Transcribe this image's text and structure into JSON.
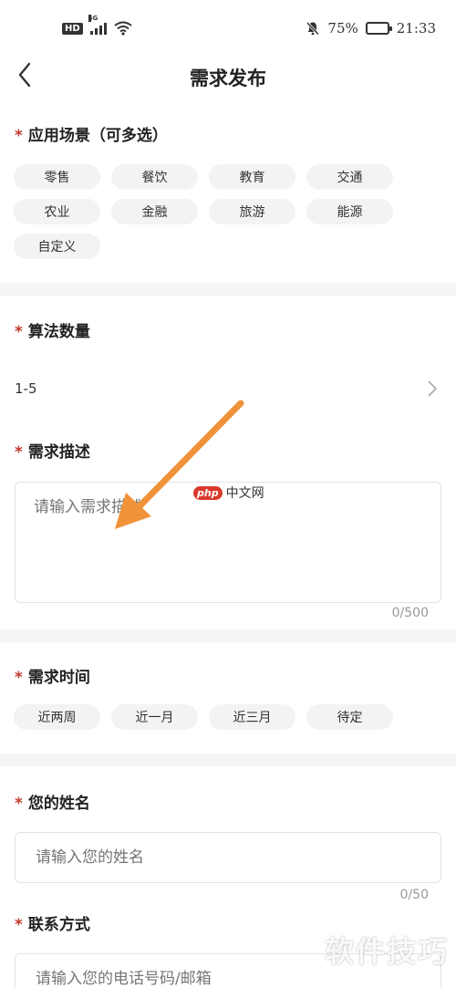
{
  "status_bar": {
    "hd": "HD",
    "network": "4G",
    "battery_percent": "75%",
    "battery_level": 0.75,
    "time": "21:33",
    "icons": [
      "hd-icon",
      "signal-icon",
      "wifi-icon",
      "mute-icon",
      "battery-icon"
    ]
  },
  "header": {
    "title": "需求发布",
    "back_icon": "chevron-left-icon"
  },
  "scenario": {
    "label": "应用场景（可多选）",
    "tags": [
      "零售",
      "餐饮",
      "教育",
      "交通",
      "农业",
      "金融",
      "旅游",
      "能源",
      "自定义"
    ]
  },
  "algorithm": {
    "label": "算法数量",
    "value": "1-5",
    "chevron_icon": "chevron-right-icon"
  },
  "description": {
    "label": "需求描述",
    "placeholder": "请输入需求描述",
    "counter": "0/500"
  },
  "time": {
    "label": "需求时间",
    "options": [
      "近两周",
      "近一月",
      "近三月",
      "待定"
    ]
  },
  "name": {
    "label": "您的姓名",
    "placeholder": "请输入您的姓名",
    "counter": "0/50"
  },
  "contact": {
    "label": "联系方式",
    "placeholder": "请输入您的电话号码/邮箱"
  },
  "required_mark": "*",
  "watermarks": {
    "php_badge": "php",
    "php_text": "中文网",
    "site_text": "软件技巧"
  },
  "colors": {
    "required": "#c0392b",
    "annotation_arrow": "#f0923a",
    "chip_bg": "#f3f3f3",
    "divider": "#f5f5f5"
  }
}
